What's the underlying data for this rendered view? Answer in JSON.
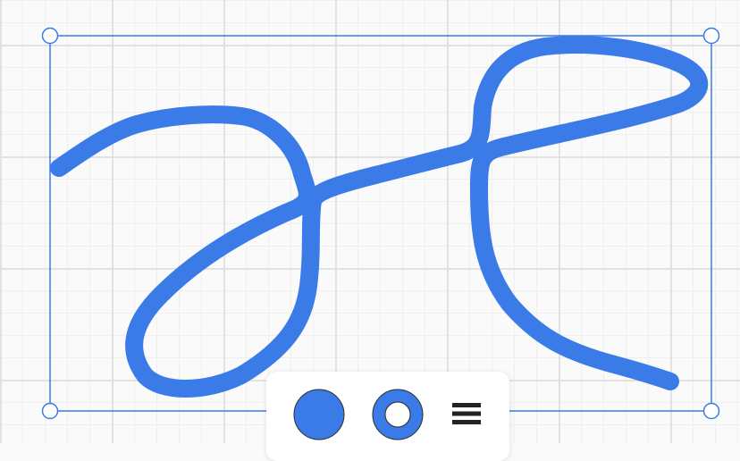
{
  "canvas": {
    "background": "#fafafa",
    "grid_minor_color": "#efefef",
    "grid_major_color": "#e2e2e2"
  },
  "stroke": {
    "color": "#3b7be8"
  },
  "selection": {
    "color": "#3b7be8"
  },
  "toolbar": {
    "items": [
      {
        "name": "fill-color-button",
        "icon": "filled-circle-icon"
      },
      {
        "name": "stroke-style-button",
        "icon": "ring-icon"
      },
      {
        "name": "menu-button",
        "icon": "hamburger-menu-icon"
      }
    ]
  }
}
